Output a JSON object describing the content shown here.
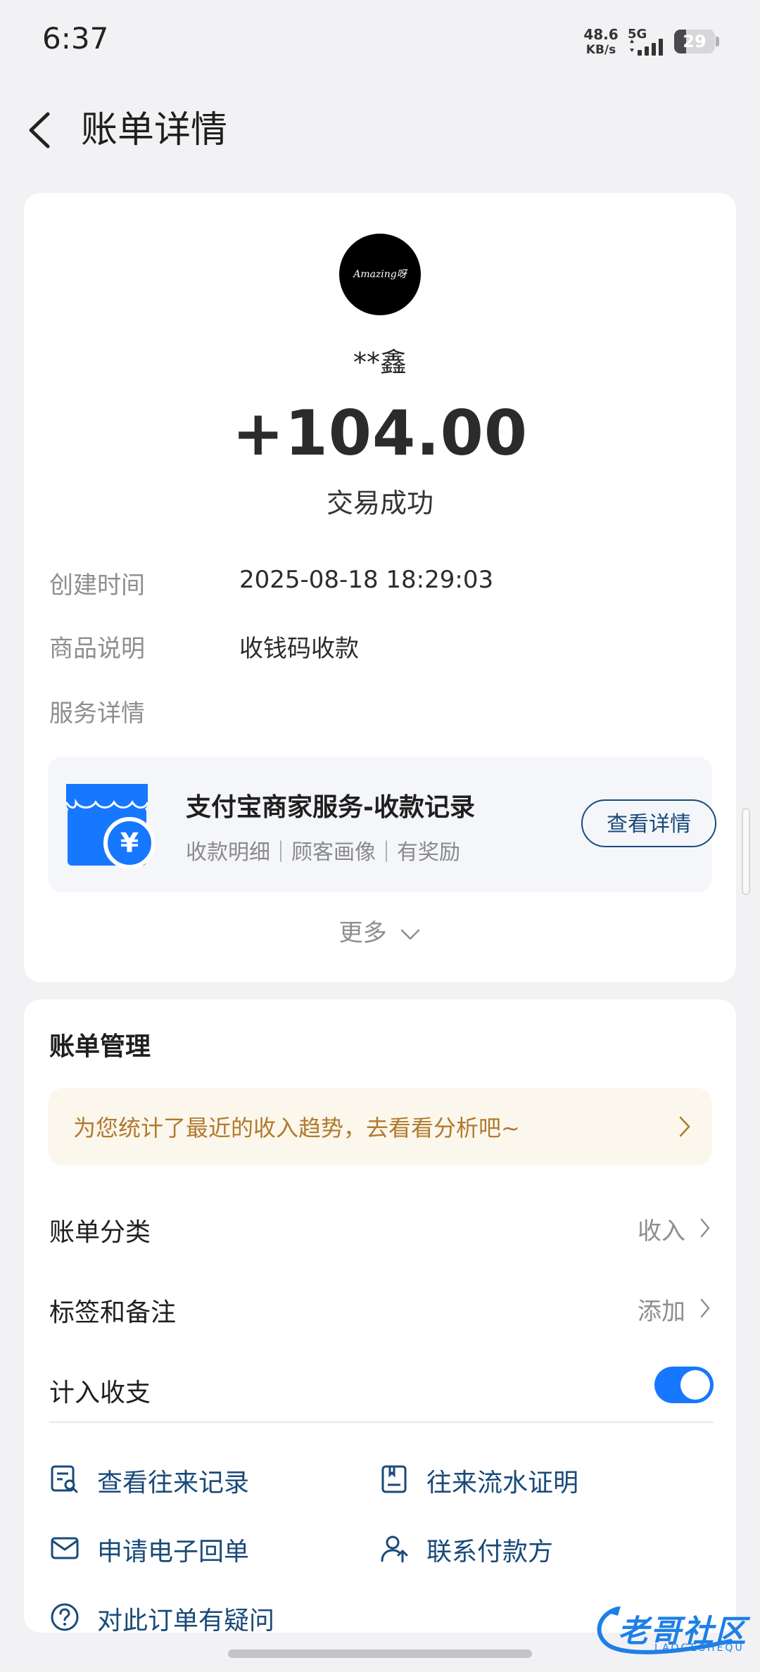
{
  "status_bar": {
    "time": "6:37",
    "net_speed": "48.6",
    "net_unit": "KB/s",
    "network": "5G",
    "battery": "29",
    "battery_fraction": 0.29
  },
  "nav": {
    "back_icon": "chevron-left-icon",
    "title": "账单详情"
  },
  "summary": {
    "avatar_text": "Amazing呀",
    "payer": "**鑫",
    "amount": "+104.00",
    "status": "交易成功"
  },
  "details": [
    {
      "label": "创建时间",
      "value": "2025-08-18 18:29:03"
    },
    {
      "label": "商品说明",
      "value": "收钱码收款"
    },
    {
      "label": "服务详情",
      "value": ""
    }
  ],
  "service": {
    "icon": "shop-icon",
    "title": "支付宝商家服务-收款记录",
    "subtitle": "收款明细｜顾客画像｜有奖励",
    "button": "查看详情"
  },
  "more_label": "更多",
  "management": {
    "title": "账单管理",
    "banner": "为您统计了最近的收入趋势，去看看分析吧~",
    "category_label": "账单分类",
    "category_value": "收入",
    "tags_label": "标签和备注",
    "tags_value": "添加",
    "include_label": "计入收支",
    "include_on": true
  },
  "actions": [
    {
      "label": "查看往来记录",
      "icon": "records-search-icon"
    },
    {
      "label": "往来流水证明",
      "icon": "statement-icon"
    },
    {
      "label": "申请电子回单",
      "icon": "envelope-icon"
    },
    {
      "label": "联系付款方",
      "icon": "contact-user-icon"
    },
    {
      "label": "对此订单有疑问",
      "icon": "question-icon"
    }
  ],
  "watermark": {
    "text": "老哥社区",
    "sub": "LAOGESHEQU"
  },
  "colors": {
    "accent": "#1677ff",
    "link": "#1a4a7a",
    "banner_text": "#b07a2e"
  }
}
